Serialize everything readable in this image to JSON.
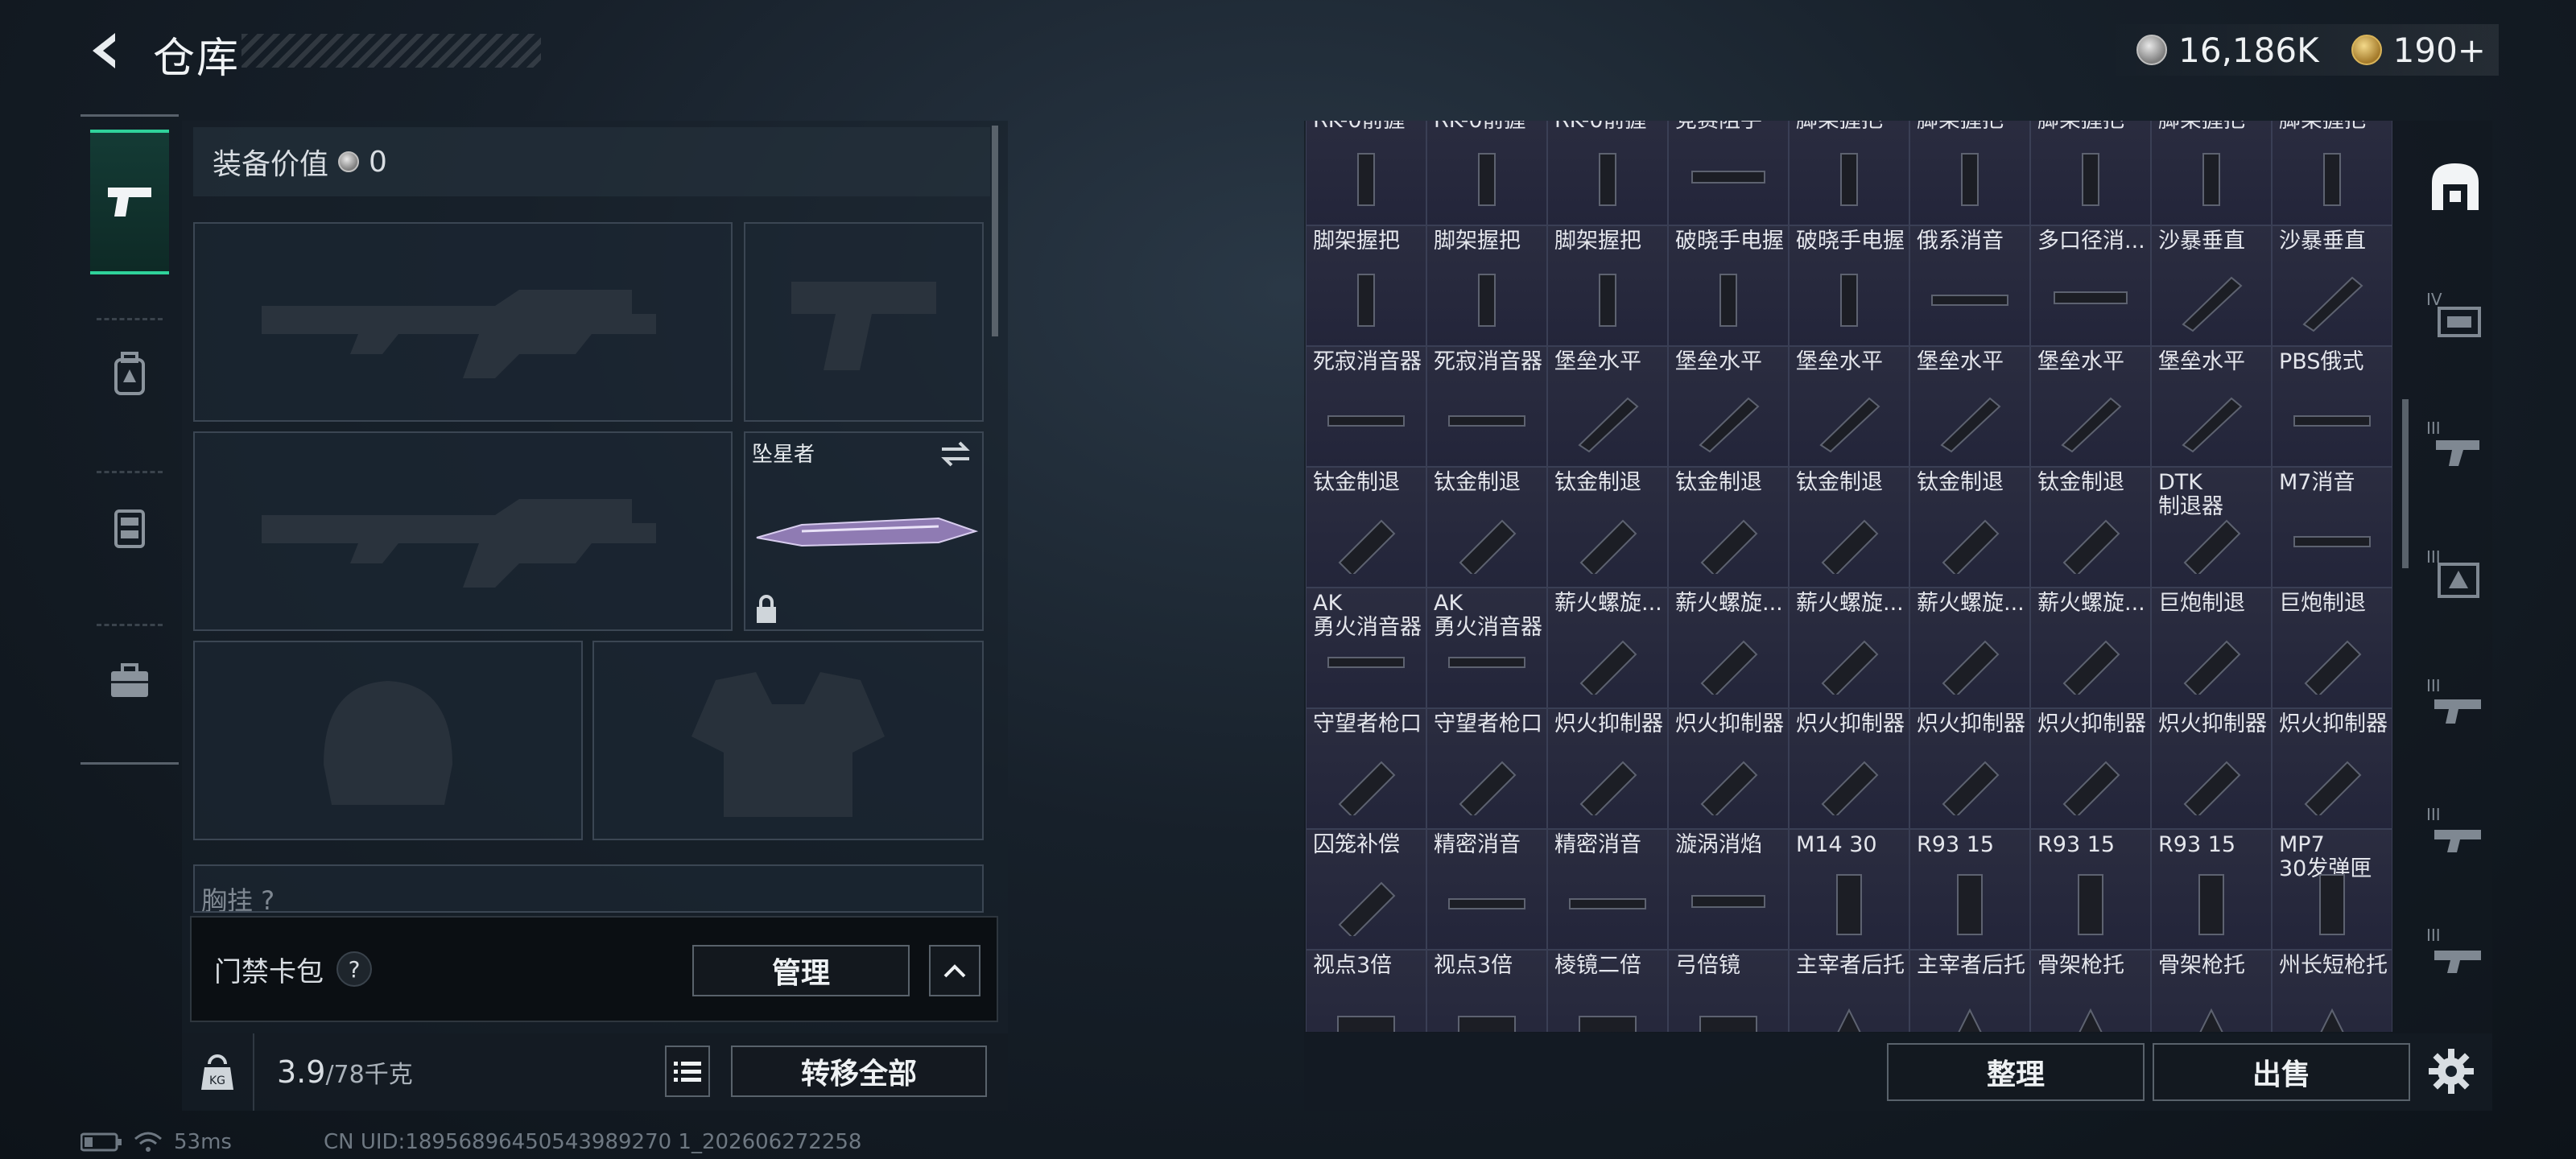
{
  "header": {
    "title": "仓库",
    "currency": [
      {
        "icon": "silver-coin-icon",
        "value": "16,186K"
      },
      {
        "icon": "gold-coin-icon",
        "value": "190+"
      }
    ]
  },
  "left_rail": {
    "items": [
      {
        "icon": "pistol-icon",
        "active": true
      },
      {
        "icon": "backpack-icon",
        "active": false
      },
      {
        "icon": "chest-rig-icon",
        "active": false
      },
      {
        "icon": "toolbox-icon",
        "active": false
      }
    ]
  },
  "equipment": {
    "value_label": "装备价值",
    "value": "0",
    "melee_label": "坠星者",
    "chest_label_partial": "胸挂 ?",
    "access_card_label": "门禁卡包",
    "help": "?",
    "manage_label": "管理",
    "weight_value": "3.9",
    "weight_cap": "/78千克",
    "kg_label": "KG",
    "transfer_all_label": "转移全部"
  },
  "status": {
    "ping": "53ms",
    "uid": "CN UID:18956896450543989270 1_202606272258"
  },
  "inventory": {
    "top_partial_row": [
      "RK-0前握",
      "RK-0前握",
      "RK-0前握",
      "竞赛阻手",
      "脚架握把",
      "脚架握把",
      "脚架握把",
      "脚架握把",
      "脚架握把"
    ],
    "rows": [
      [
        "脚架握把",
        "脚架握把",
        "脚架握把",
        "破晓手电握",
        "破晓手电握",
        "俄系消音",
        "多口径消...",
        "沙暴垂直",
        "沙暴垂直"
      ],
      [
        "死寂消音器",
        "死寂消音器",
        "堡垒水平",
        "堡垒水平",
        "堡垒水平",
        "堡垒水平",
        "堡垒水平",
        "堡垒水平",
        "PBS俄式"
      ],
      [
        "钛金制退",
        "钛金制退",
        "钛金制退",
        "钛金制退",
        "钛金制退",
        "钛金制退",
        "钛金制退",
        "DTK\n制退器",
        "M7消音"
      ],
      [
        "AK\n勇火消音器",
        "AK\n勇火消音器",
        "薪火螺旋...",
        "薪火螺旋...",
        "薪火螺旋...",
        "薪火螺旋...",
        "薪火螺旋...",
        "巨炮制退",
        "巨炮制退"
      ],
      [
        "守望者枪口",
        "守望者枪口",
        "炽火抑制器",
        "炽火抑制器",
        "炽火抑制器",
        "炽火抑制器",
        "炽火抑制器",
        "炽火抑制器",
        "炽火抑制器"
      ],
      [
        "囚笼补偿",
        "精密消音",
        "精密消音",
        "漩涡消焰",
        "M14 30",
        "R93 15",
        "R93 15",
        "R93 15",
        "MP7\n30发弹匣"
      ],
      [
        "视点3倍",
        "视点3倍",
        "棱镜二倍",
        "弓倍镜",
        "主宰者后托",
        "主宰者后托",
        "骨架枪托",
        "骨架枪托",
        "州长短枪托"
      ]
    ],
    "sort_label": "整理",
    "sell_label": "出售"
  },
  "right_rail": {
    "tabs": [
      {
        "icon": "all-items-icon",
        "label": ""
      },
      {
        "icon": "attachments-icon",
        "label": "IV"
      },
      {
        "icon": "weapon-tier-icon",
        "label": "III"
      },
      {
        "icon": "armor-tier-icon",
        "label": "III"
      },
      {
        "icon": "gear-tier-icon",
        "label": "III"
      },
      {
        "icon": "ammo-tier-icon",
        "label": "III"
      },
      {
        "icon": "misc-tier-icon",
        "label": "III"
      }
    ],
    "settings_icon": "settings-icon"
  }
}
